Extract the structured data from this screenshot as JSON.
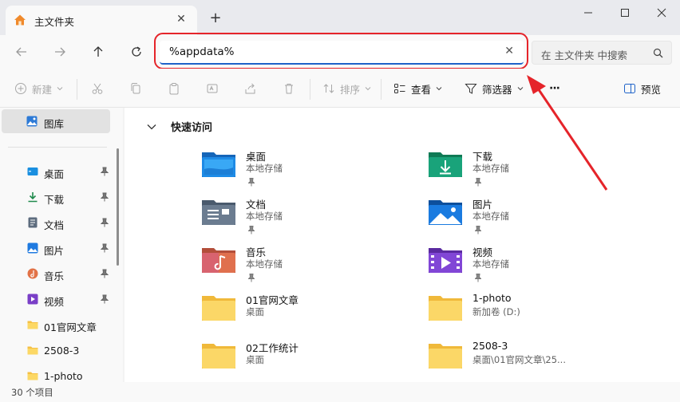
{
  "window": {
    "tab_title": "主文件夹",
    "new_tab": "+",
    "tab_close": "✕"
  },
  "address": {
    "value": "%appdata%",
    "clear": "✕"
  },
  "search": {
    "placeholder": "在 主文件夹 中搜索"
  },
  "toolbar": {
    "new_label": "新建",
    "sort_label": "排序",
    "view_label": "查看",
    "filter_label": "筛选器",
    "more_label": "···",
    "preview_label": "预览"
  },
  "sidebar": {
    "gallery": "图库",
    "items": [
      {
        "label": "桌面",
        "icon": "desktop-icon",
        "pinned": true
      },
      {
        "label": "下载",
        "icon": "download-icon",
        "pinned": true
      },
      {
        "label": "文档",
        "icon": "document-icon",
        "pinned": true
      },
      {
        "label": "图片",
        "icon": "picture-icon",
        "pinned": true
      },
      {
        "label": "音乐",
        "icon": "music-icon",
        "pinned": true
      },
      {
        "label": "视频",
        "icon": "video-icon",
        "pinned": true
      },
      {
        "label": "01官网文章",
        "icon": "folder-icon",
        "pinned": false
      },
      {
        "label": "2508-3",
        "icon": "folder-icon",
        "pinned": false
      },
      {
        "label": "1-photo",
        "icon": "folder-icon",
        "pinned": false
      }
    ]
  },
  "main": {
    "section_title": "快速访问",
    "items": [
      {
        "name": "桌面",
        "sub": "本地存储",
        "type": "desktop",
        "pinned": true
      },
      {
        "name": "下载",
        "sub": "本地存储",
        "type": "download",
        "pinned": true
      },
      {
        "name": "文档",
        "sub": "本地存储",
        "type": "document",
        "pinned": true
      },
      {
        "name": "图片",
        "sub": "本地存储",
        "type": "picture",
        "pinned": true
      },
      {
        "name": "音乐",
        "sub": "本地存储",
        "type": "music",
        "pinned": true
      },
      {
        "name": "视频",
        "sub": "本地存储",
        "type": "video",
        "pinned": true
      },
      {
        "name": "01官网文章",
        "sub": "桌面",
        "type": "folder",
        "pinned": false
      },
      {
        "name": "1-photo",
        "sub": "新加卷 (D:)",
        "type": "folder",
        "pinned": false
      },
      {
        "name": "02工作统计",
        "sub": "桌面",
        "type": "folder",
        "pinned": false
      },
      {
        "name": "2508-3",
        "sub": "桌面\\01官网文章\\25...",
        "type": "folder",
        "pinned": false
      }
    ]
  },
  "status": {
    "item_count": "30 个项目"
  },
  "colors": {
    "accent": "#1f63c9",
    "highlight": "#e5242a",
    "folder": "#f7c948"
  }
}
